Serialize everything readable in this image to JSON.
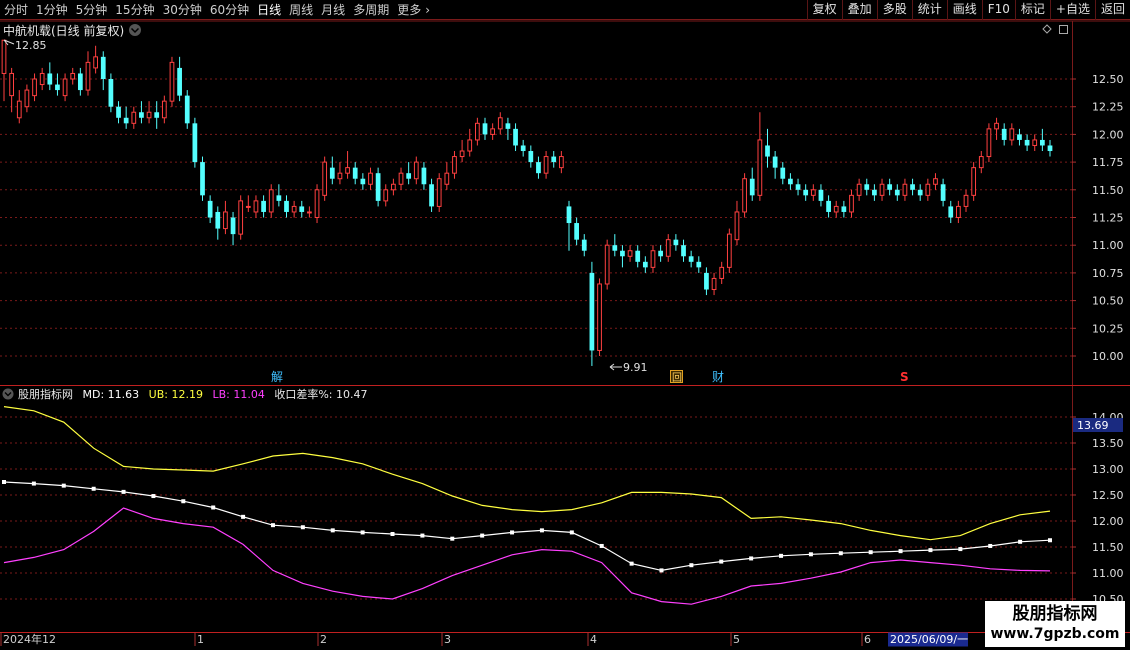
{
  "toolbar": {
    "period_tabs": [
      "分时",
      "1分钟",
      "5分钟",
      "15分钟",
      "30分钟",
      "60分钟",
      "日线",
      "周线",
      "月线",
      "多周期",
      "更多"
    ],
    "active_tab": "日线",
    "more_arrow": "more-chevron-icon",
    "tools": [
      "复权",
      "叠加",
      "多股",
      "统计",
      "画线",
      "F10",
      "标记",
      "+自选",
      "返回"
    ]
  },
  "main_chart": {
    "title": "中航机载(日线 前复权)",
    "price_axis": [
      "12.50",
      "12.25",
      "12.00",
      "11.75",
      "11.50",
      "11.25",
      "11.00",
      "10.75",
      "10.50",
      "10.25",
      "10.00"
    ],
    "high_label": "12.85",
    "low_label": "9.91",
    "event_markers": {
      "jie": "解",
      "hui": "回",
      "cai": "财",
      "s": "S"
    }
  },
  "indicator": {
    "name": "股朋指标网",
    "md_label": "MD: 11.63",
    "ub_label": "UB: 12.19",
    "lb_label": "LB: 11.04",
    "ratio_label": "收口差率%: 10.47",
    "axis": [
      "14.00",
      "13.50",
      "13.00",
      "12.50",
      "12.00",
      "11.50",
      "11.00",
      "10.50"
    ],
    "current_value": "13.69"
  },
  "date_axis": {
    "labels": [
      "2024年12",
      "1",
      "2",
      "3",
      "4",
      "5",
      "6"
    ],
    "cursor_date": "2025/06/09/一"
  },
  "watermark": {
    "title": "股朋指标网",
    "url": "www.7gpzb.com"
  },
  "colors": {
    "up": "#ff4040",
    "down": "#54ffff",
    "md": "#ffffff",
    "ub": "#ffff40",
    "lb": "#ff40ff",
    "grid": "#7a1a1a"
  },
  "chart_data": {
    "type": "candlestick",
    "ylim": [
      9.85,
      12.95
    ],
    "candles": [
      [
        12.55,
        12.85,
        12.85,
        12.3
      ],
      [
        12.35,
        12.55,
        12.6,
        12.2
      ],
      [
        12.15,
        12.3,
        12.4,
        12.1
      ],
      [
        12.25,
        12.4,
        12.45,
        12.2
      ],
      [
        12.35,
        12.5,
        12.55,
        12.3
      ],
      [
        12.45,
        12.55,
        12.6,
        12.4
      ],
      [
        12.55,
        12.45,
        12.65,
        12.4
      ],
      [
        12.45,
        12.4,
        12.55,
        12.35
      ],
      [
        12.35,
        12.5,
        12.55,
        12.3
      ],
      [
        12.5,
        12.55,
        12.6,
        12.45
      ],
      [
        12.55,
        12.4,
        12.6,
        12.35
      ],
      [
        12.4,
        12.65,
        12.75,
        12.35
      ],
      [
        12.6,
        12.7,
        12.8,
        12.55
      ],
      [
        12.7,
        12.5,
        12.75,
        12.4
      ],
      [
        12.5,
        12.25,
        12.55,
        12.2
      ],
      [
        12.25,
        12.15,
        12.3,
        12.1
      ],
      [
        12.15,
        12.1,
        12.25,
        12.05
      ],
      [
        12.1,
        12.2,
        12.25,
        12.05
      ],
      [
        12.2,
        12.15,
        12.3,
        12.1
      ],
      [
        12.15,
        12.2,
        12.3,
        12.1
      ],
      [
        12.2,
        12.15,
        12.3,
        12.05
      ],
      [
        12.15,
        12.3,
        12.35,
        12.1
      ],
      [
        12.3,
        12.65,
        12.7,
        12.25
      ],
      [
        12.6,
        12.35,
        12.7,
        12.3
      ],
      [
        12.35,
        12.1,
        12.4,
        12.05
      ],
      [
        12.1,
        11.75,
        12.15,
        11.7
      ],
      [
        11.75,
        11.45,
        11.8,
        11.4
      ],
      [
        11.4,
        11.25,
        11.45,
        11.2
      ],
      [
        11.3,
        11.15,
        11.35,
        11.05
      ],
      [
        11.15,
        11.3,
        11.4,
        11.1
      ],
      [
        11.25,
        11.1,
        11.3,
        11.0
      ],
      [
        11.1,
        11.4,
        11.45,
        11.05
      ],
      [
        11.35,
        11.35,
        11.45,
        11.3
      ],
      [
        11.3,
        11.4,
        11.45,
        11.25
      ],
      [
        11.4,
        11.3,
        11.45,
        11.25
      ],
      [
        11.3,
        11.5,
        11.55,
        11.25
      ],
      [
        11.45,
        11.4,
        11.55,
        11.35
      ],
      [
        11.4,
        11.3,
        11.45,
        11.25
      ],
      [
        11.3,
        11.35,
        11.4,
        11.25
      ],
      [
        11.35,
        11.3,
        11.4,
        11.25
      ],
      [
        11.3,
        11.3,
        11.35,
        11.25
      ],
      [
        11.25,
        11.5,
        11.55,
        11.2
      ],
      [
        11.45,
        11.75,
        11.8,
        11.4
      ],
      [
        11.7,
        11.6,
        11.8,
        11.55
      ],
      [
        11.6,
        11.65,
        11.75,
        11.55
      ],
      [
        11.65,
        11.7,
        11.85,
        11.6
      ],
      [
        11.7,
        11.6,
        11.75,
        11.55
      ],
      [
        11.6,
        11.55,
        11.65,
        11.5
      ],
      [
        11.55,
        11.65,
        11.7,
        11.5
      ],
      [
        11.65,
        11.4,
        11.7,
        11.35
      ],
      [
        11.4,
        11.5,
        11.55,
        11.35
      ],
      [
        11.5,
        11.55,
        11.6,
        11.45
      ],
      [
        11.55,
        11.65,
        11.7,
        11.5
      ],
      [
        11.65,
        11.6,
        11.75,
        11.55
      ],
      [
        11.6,
        11.75,
        11.8,
        11.55
      ],
      [
        11.7,
        11.55,
        11.75,
        11.5
      ],
      [
        11.55,
        11.35,
        11.6,
        11.3
      ],
      [
        11.35,
        11.6,
        11.65,
        11.3
      ],
      [
        11.55,
        11.65,
        11.75,
        11.5
      ],
      [
        11.65,
        11.8,
        11.85,
        11.6
      ],
      [
        11.8,
        11.85,
        11.95,
        11.75
      ],
      [
        11.85,
        11.95,
        12.05,
        11.8
      ],
      [
        11.95,
        12.1,
        12.15,
        11.9
      ],
      [
        12.1,
        12.0,
        12.15,
        11.95
      ],
      [
        12.0,
        12.05,
        12.1,
        11.95
      ],
      [
        12.05,
        12.15,
        12.2,
        12.0
      ],
      [
        12.1,
        12.05,
        12.15,
        11.95
      ],
      [
        12.05,
        11.9,
        12.1,
        11.85
      ],
      [
        11.9,
        11.85,
        11.95,
        11.8
      ],
      [
        11.85,
        11.75,
        11.9,
        11.7
      ],
      [
        11.75,
        11.65,
        11.8,
        11.6
      ],
      [
        11.65,
        11.8,
        11.85,
        11.6
      ],
      [
        11.8,
        11.75,
        11.85,
        11.7
      ],
      [
        11.7,
        11.8,
        11.85,
        11.65
      ],
      [
        11.35,
        11.2,
        11.4,
        10.95
      ],
      [
        11.2,
        11.05,
        11.25,
        11.0
      ],
      [
        11.05,
        10.95,
        11.1,
        10.9
      ],
      [
        10.75,
        10.05,
        10.85,
        9.91
      ],
      [
        10.05,
        10.65,
        10.7,
        10.0
      ],
      [
        10.65,
        11.0,
        11.05,
        10.6
      ],
      [
        11.0,
        10.95,
        11.1,
        10.9
      ],
      [
        10.95,
        10.9,
        11.0,
        10.8
      ],
      [
        10.9,
        10.95,
        11.0,
        10.85
      ],
      [
        10.95,
        10.85,
        11.0,
        10.8
      ],
      [
        10.85,
        10.8,
        10.9,
        10.75
      ],
      [
        10.8,
        10.95,
        11.0,
        10.75
      ],
      [
        10.95,
        10.9,
        11.0,
        10.85
      ],
      [
        10.9,
        11.05,
        11.1,
        10.85
      ],
      [
        11.05,
        11.0,
        11.1,
        10.95
      ],
      [
        11.0,
        10.9,
        11.05,
        10.85
      ],
      [
        10.9,
        10.85,
        10.95,
        10.8
      ],
      [
        10.85,
        10.8,
        10.9,
        10.75
      ],
      [
        10.75,
        10.6,
        10.8,
        10.55
      ],
      [
        10.6,
        10.7,
        10.75,
        10.55
      ],
      [
        10.7,
        10.8,
        10.85,
        10.65
      ],
      [
        10.8,
        11.1,
        11.15,
        10.75
      ],
      [
        11.05,
        11.3,
        11.4,
        11.0
      ],
      [
        11.3,
        11.6,
        11.65,
        11.25
      ],
      [
        11.6,
        11.45,
        11.7,
        11.4
      ],
      [
        11.45,
        11.95,
        12.2,
        11.4
      ],
      [
        11.9,
        11.8,
        12.05,
        11.7
      ],
      [
        11.8,
        11.7,
        11.85,
        11.6
      ],
      [
        11.7,
        11.6,
        11.75,
        11.55
      ],
      [
        11.6,
        11.55,
        11.65,
        11.5
      ],
      [
        11.55,
        11.5,
        11.6,
        11.45
      ],
      [
        11.5,
        11.45,
        11.55,
        11.4
      ],
      [
        11.45,
        11.5,
        11.55,
        11.4
      ],
      [
        11.5,
        11.4,
        11.55,
        11.35
      ],
      [
        11.4,
        11.3,
        11.45,
        11.25
      ],
      [
        11.3,
        11.35,
        11.4,
        11.25
      ],
      [
        11.35,
        11.3,
        11.4,
        11.25
      ],
      [
        11.3,
        11.45,
        11.5,
        11.25
      ],
      [
        11.45,
        11.55,
        11.6,
        11.4
      ],
      [
        11.55,
        11.5,
        11.6,
        11.45
      ],
      [
        11.5,
        11.45,
        11.55,
        11.4
      ],
      [
        11.45,
        11.55,
        11.6,
        11.4
      ],
      [
        11.55,
        11.5,
        11.6,
        11.45
      ],
      [
        11.5,
        11.45,
        11.55,
        11.4
      ],
      [
        11.45,
        11.55,
        11.6,
        11.4
      ],
      [
        11.55,
        11.5,
        11.6,
        11.45
      ],
      [
        11.5,
        11.45,
        11.55,
        11.4
      ],
      [
        11.45,
        11.55,
        11.6,
        11.4
      ],
      [
        11.55,
        11.6,
        11.65,
        11.5
      ],
      [
        11.55,
        11.4,
        11.6,
        11.35
      ],
      [
        11.35,
        11.25,
        11.4,
        11.2
      ],
      [
        11.25,
        11.35,
        11.4,
        11.2
      ],
      [
        11.35,
        11.45,
        11.5,
        11.3
      ],
      [
        11.45,
        11.7,
        11.75,
        11.4
      ],
      [
        11.7,
        11.8,
        11.85,
        11.65
      ],
      [
        11.8,
        12.05,
        12.1,
        11.75
      ],
      [
        12.05,
        12.1,
        12.15,
        11.95
      ],
      [
        12.05,
        11.95,
        12.1,
        11.9
      ],
      [
        11.95,
        12.05,
        12.1,
        11.9
      ],
      [
        12.0,
        11.95,
        12.05,
        11.9
      ],
      [
        11.95,
        11.9,
        12.0,
        11.85
      ],
      [
        11.9,
        11.95,
        12.0,
        11.85
      ],
      [
        11.95,
        11.9,
        12.05,
        11.85
      ],
      [
        11.9,
        11.85,
        11.95,
        11.8
      ]
    ],
    "indicator_series": {
      "md": [
        12.75,
        12.72,
        12.68,
        12.62,
        12.56,
        12.48,
        12.38,
        12.26,
        12.08,
        11.92,
        11.88,
        11.82,
        11.78,
        11.75,
        11.72,
        11.66,
        11.72,
        11.78,
        11.82,
        11.78,
        11.52,
        11.18,
        11.05,
        11.15,
        11.22,
        11.28,
        11.33,
        11.36,
        11.38,
        11.4,
        11.42,
        11.44,
        11.46,
        11.52,
        11.6,
        11.63
      ],
      "ub": [
        14.2,
        14.12,
        13.9,
        13.4,
        13.05,
        13.0,
        12.98,
        12.96,
        13.1,
        13.25,
        13.3,
        13.22,
        13.1,
        12.9,
        12.72,
        12.48,
        12.3,
        12.22,
        12.18,
        12.22,
        12.35,
        12.55,
        12.55,
        12.52,
        12.45,
        12.05,
        12.08,
        12.02,
        11.95,
        11.82,
        11.72,
        11.64,
        11.72,
        11.95,
        12.12,
        12.19
      ],
      "lb": [
        11.2,
        11.3,
        11.45,
        11.8,
        12.25,
        12.05,
        11.95,
        11.88,
        11.55,
        11.05,
        10.8,
        10.65,
        10.55,
        10.5,
        10.7,
        10.95,
        11.15,
        11.35,
        11.45,
        11.42,
        11.2,
        10.62,
        10.45,
        10.4,
        10.55,
        10.75,
        10.8,
        10.9,
        11.02,
        11.2,
        11.25,
        11.2,
        11.15,
        11.08,
        11.05,
        11.04
      ]
    }
  }
}
